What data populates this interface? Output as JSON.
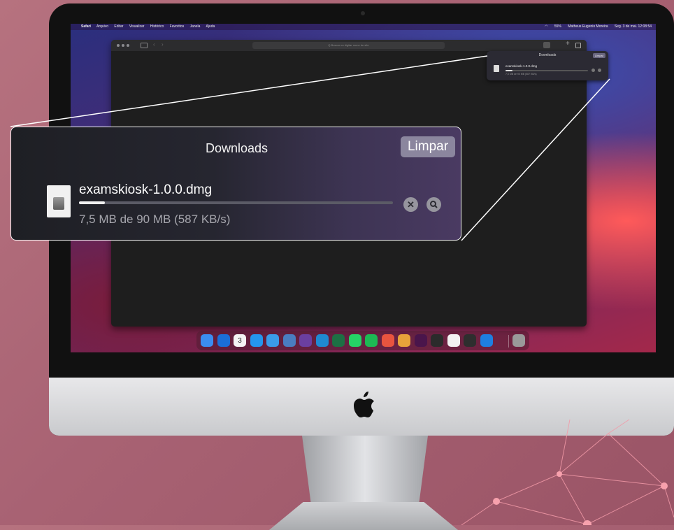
{
  "menubar": {
    "apple": "",
    "items": [
      "Safari",
      "Arquivo",
      "Editar",
      "Visualizar",
      "Histórico",
      "Favoritos",
      "Janela",
      "Ajuda"
    ],
    "right": {
      "battery": "55%",
      "user": "Matheus Eugenio Moreira",
      "datetime": "Seg. 3 de mai.  12:08:54"
    }
  },
  "safari": {
    "address_placeholder": "Q Buscar ou digitar nome de site"
  },
  "downloads_popover": {
    "title": "Downloads",
    "clear_label": "Limpar",
    "file": {
      "name": "examskiosk-1.0.0.dmg",
      "status": "7,5 MB de 90 MB (587 KB/s)",
      "progress": 0.083
    },
    "mini_status": "7,5 MB de 90 MB (587 KB/s)"
  },
  "dock": {
    "calendar_day": "3",
    "apps": [
      {
        "name": "finder-icon",
        "color": "#3b8df0"
      },
      {
        "name": "1password-icon",
        "color": "#1a6fd8"
      },
      {
        "name": "calendar-icon",
        "color": "#f4f4f4"
      },
      {
        "name": "docker-icon",
        "color": "#2496ed"
      },
      {
        "name": "docker-desktop-icon",
        "color": "#3a9be8"
      },
      {
        "name": "chess-icon",
        "color": "#4a7dc0"
      },
      {
        "name": "visual-studio-icon",
        "color": "#6b3fa0"
      },
      {
        "name": "vscode-icon",
        "color": "#1f8ad2"
      },
      {
        "name": "excel-icon",
        "color": "#1d7044"
      },
      {
        "name": "whatsapp-icon",
        "color": "#25d366"
      },
      {
        "name": "spotify-icon",
        "color": "#1db954"
      },
      {
        "name": "git-client-icon",
        "color": "#e8543f"
      },
      {
        "name": "chrome-dev-icon",
        "color": "#e7a33a"
      },
      {
        "name": "slack-icon",
        "color": "#4a154b"
      },
      {
        "name": "terminal-icon",
        "color": "#2b2b2b"
      },
      {
        "name": "notion-icon",
        "color": "#f2f2f2"
      },
      {
        "name": "activity-monitor-icon",
        "color": "#2e2e2e"
      },
      {
        "name": "safari-icon",
        "color": "#1e7fe0"
      },
      {
        "name": "trash-icon",
        "color": "#9a9a9a"
      }
    ]
  }
}
